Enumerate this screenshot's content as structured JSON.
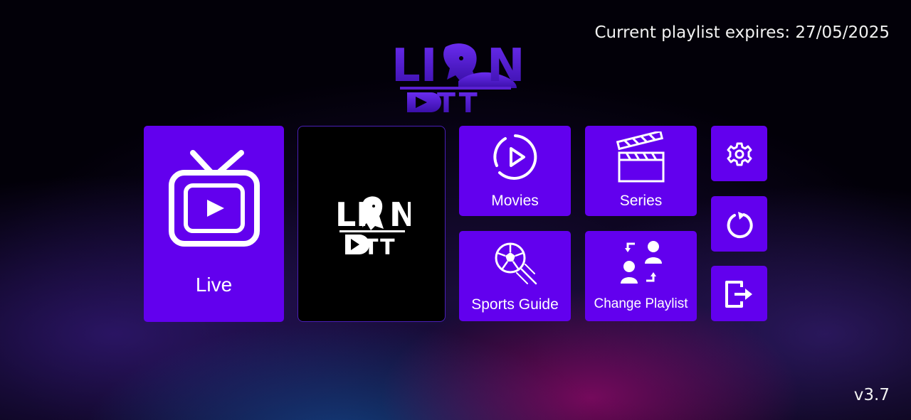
{
  "header": {
    "expiry_text": "Current playlist expires: 27/05/2025"
  },
  "brand": {
    "word_top": "LI",
    "word_top_end": "N",
    "word_bottom": "TT"
  },
  "tiles": {
    "live": {
      "label": "Live",
      "icon": "tv-icon"
    },
    "movies": {
      "label": "Movies",
      "icon": "play-circle-icon"
    },
    "series": {
      "label": "Series",
      "icon": "clapperboard-icon"
    },
    "sports_guide": {
      "label": "Sports Guide",
      "icon": "soccer-ball-icon"
    },
    "change_playlist": {
      "label": "Change Playlist",
      "icon": "swap-users-icon"
    },
    "settings": {
      "icon": "gear-icon"
    },
    "refresh": {
      "icon": "refresh-icon"
    },
    "exit": {
      "icon": "exit-icon"
    }
  },
  "footer": {
    "version": "v3.7"
  },
  "colors": {
    "tile": "#6200ee",
    "logo_purple": "#5a1fd1"
  }
}
